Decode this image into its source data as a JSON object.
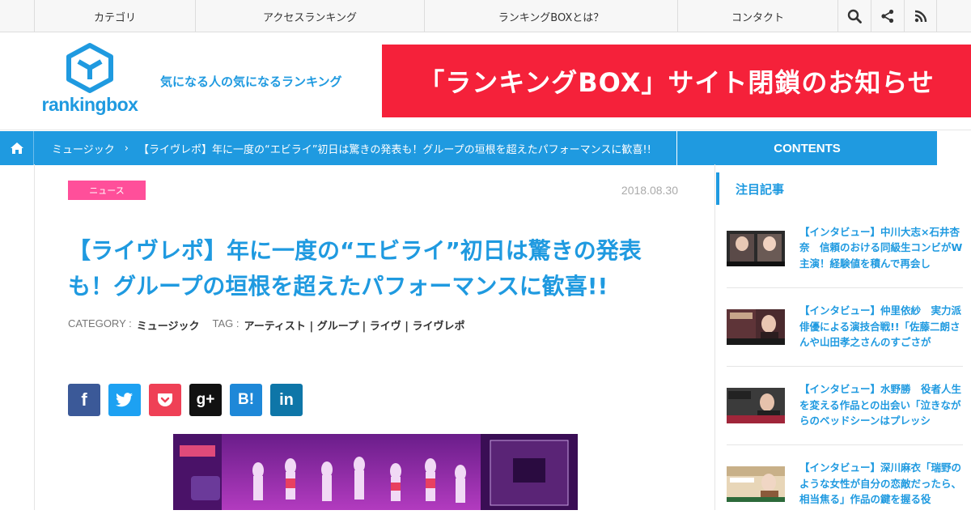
{
  "nav": {
    "items": [
      "カテゴリ",
      "アクセスランキング",
      "ランキングBOXとは？",
      "コンタクト"
    ],
    "icons": [
      "search-icon",
      "share-icon",
      "rss-icon"
    ]
  },
  "header": {
    "logo_text": "rankingbox",
    "tagline": "気になる人の気になるランキング",
    "banner": "「ランキングBOX」サイト閉鎖のお知らせ"
  },
  "breadcrumb": {
    "category": "ミュージック",
    "separator": "›",
    "current": "【ライヴレポ】年に一度の“エビライ”初日は驚きの発表も！グループの垣根を超えたパフォーマンスに歓喜!!",
    "contents_label": "CONTENTS"
  },
  "article": {
    "badge": "ニュース",
    "date": "2018.08.30",
    "title": "【ライヴレポ】年に一度の“エビライ”初日は驚きの発表も！グループの垣根を超えたパフォーマンスに歓喜!!",
    "category_label": "CATEGORY :",
    "category": "ミュージック",
    "tag_label": "TAG :",
    "tags": "アーティスト | グループ | ライヴ | ライヴレポ",
    "share": [
      {
        "name": "facebook",
        "glyph": "f",
        "color": "#3b5998"
      },
      {
        "name": "twitter",
        "glyph": "",
        "color": "#1da1f2"
      },
      {
        "name": "pocket",
        "glyph": "",
        "color": "#ef4056"
      },
      {
        "name": "google-plus",
        "glyph": "g+",
        "color": "#111111"
      },
      {
        "name": "hatena",
        "glyph": "B!",
        "color": "#1e88d8"
      },
      {
        "name": "linkedin",
        "glyph": "in",
        "color": "#0e76a8"
      }
    ]
  },
  "sidebar": {
    "heading": "注目記事",
    "items": [
      {
        "text": "【インタビュー】中川大志×石井杏奈　信頼のおける同級生コンビがW主演！経験値を積んで再会し"
      },
      {
        "text": "【インタビュー】仲里依紗　実力派俳優による演技合戦!!「佐藤二朗さんや山田孝之さんのすごさが"
      },
      {
        "text": "【インタビュー】水野勝　役者人生を変える作品との出会い「泣きながらのベッドシーンはプレッシ"
      },
      {
        "text": "【インタビュー】深川麻衣「瑞野のような女性が自分の恋敵だったら、相当焦る」作品の鍵を握る役"
      }
    ]
  },
  "colors": {
    "accent": "#1f9ae0",
    "banner": "#f5213a",
    "badge": "#ff4f9a"
  }
}
